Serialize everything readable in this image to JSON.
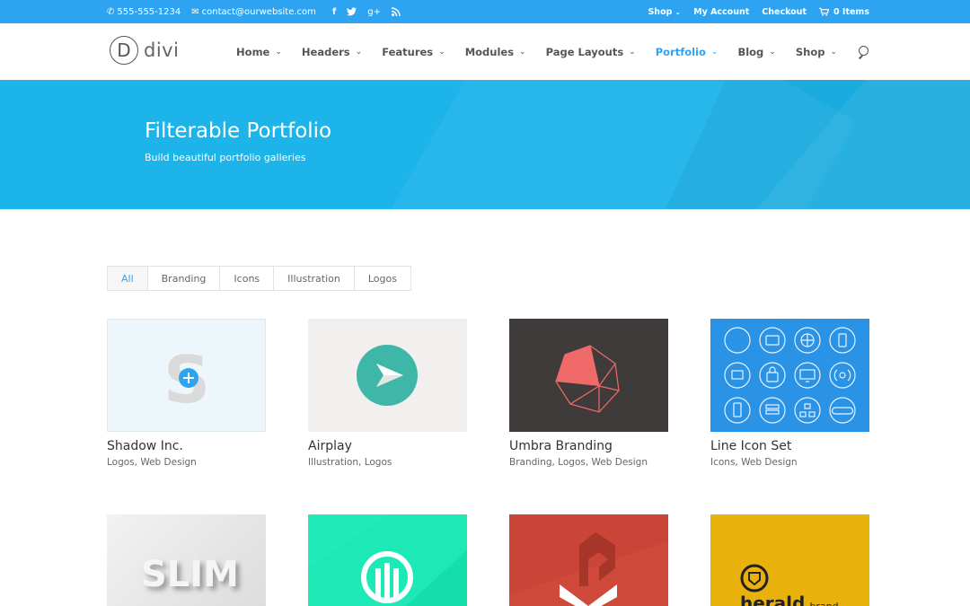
{
  "topbar": {
    "phone": "555-555-1234",
    "email": "contact@ourwebsite.com",
    "social": [
      "facebook-icon",
      "twitter-icon",
      "google-plus-icon",
      "rss-icon"
    ],
    "links": [
      {
        "label": "Shop",
        "has_dropdown": true
      },
      {
        "label": "My Account"
      },
      {
        "label": "Checkout"
      },
      {
        "label": "0 Items"
      }
    ]
  },
  "header": {
    "logo_letter": "D",
    "logo_word": "divi",
    "nav": [
      {
        "label": "Home",
        "active": false
      },
      {
        "label": "Headers",
        "active": false
      },
      {
        "label": "Features",
        "active": false
      },
      {
        "label": "Modules",
        "active": false
      },
      {
        "label": "Page Layouts",
        "active": false
      },
      {
        "label": "Portfolio",
        "active": true
      },
      {
        "label": "Blog",
        "active": false
      },
      {
        "label": "Shop",
        "active": false
      }
    ]
  },
  "hero": {
    "title": "Filterable Portfolio",
    "subtitle": "Build beautiful portfolio galleries"
  },
  "filters": [
    {
      "label": "All",
      "active": true
    },
    {
      "label": "Branding",
      "active": false
    },
    {
      "label": "Icons",
      "active": false
    },
    {
      "label": "Illustration",
      "active": false
    },
    {
      "label": "Logos",
      "active": false
    }
  ],
  "portfolio": [
    {
      "title": "Shadow Inc.",
      "categories": "Logos, Web Design"
    },
    {
      "title": "Airplay",
      "categories": "Illustration, Logos"
    },
    {
      "title": "Umbra Branding",
      "categories": "Branding, Logos, Web Design"
    },
    {
      "title": "Line Icon Set",
      "categories": "Icons, Web Design"
    },
    {
      "title": "",
      "categories": "",
      "thumb_text": "SLIM"
    },
    {
      "title": "",
      "categories": ""
    },
    {
      "title": "",
      "categories": ""
    },
    {
      "title": "",
      "categories": "",
      "thumb_text": "herald",
      "thumb_text_small": "brand"
    }
  ],
  "colors": {
    "accent": "#2ea3f2",
    "hero": "#1cb4e9",
    "teal": "#1de9b6",
    "red": "#d04a3c",
    "yellow": "#e8b10c"
  }
}
